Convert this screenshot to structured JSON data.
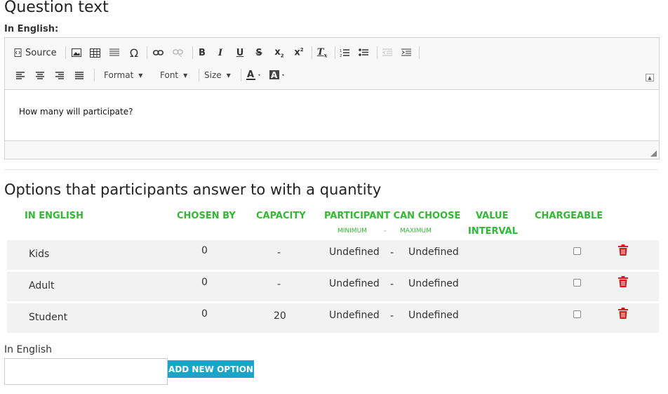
{
  "question": {
    "heading": "Question text",
    "language_label": "In English:"
  },
  "editor": {
    "toolbar_row1": {
      "source_label": "Source",
      "icons": [
        "image-icon",
        "table-icon",
        "horizontal-line-icon",
        "special-char-icon",
        "link-icon",
        "unlink-icon",
        "bold-icon",
        "italic-icon",
        "underline-icon",
        "strikethrough-icon",
        "subscript-icon",
        "superscript-icon",
        "remove-format-icon",
        "numbered-list-icon",
        "bulleted-list-icon",
        "decrease-indent-icon",
        "increase-indent-icon"
      ]
    },
    "toolbar_row2": {
      "format_label": "Format",
      "font_label": "Font",
      "size_label": "Size",
      "icons": [
        "align-left-icon",
        "align-center-icon",
        "align-right-icon",
        "justify-icon",
        "text-color-icon",
        "background-color-icon"
      ]
    },
    "content_text": "How many will participate?"
  },
  "options": {
    "heading": "Options that participants answer to with a quantity",
    "headers": {
      "language": "IN ENGLISH",
      "chosen_by": "CHOSEN BY",
      "capacity": "CAPACITY",
      "participant_can_choose": "PARTICIPANT CAN CHOOSE",
      "minimum": "MINIMUM",
      "range_separator": "-",
      "maximum": "MAXIMUM",
      "value_line1": "VALUE",
      "value_line2": "INTERVAL",
      "chargeable": "CHARGEABLE"
    },
    "rows": [
      {
        "name": "Kids",
        "chosen_by": "0",
        "capacity": "-",
        "minimum": "Undefined",
        "separator": "-",
        "maximum": "Undefined",
        "chargeable": false
      },
      {
        "name": "Adult",
        "chosen_by": "0",
        "capacity": "-",
        "minimum": "Undefined",
        "separator": "-",
        "maximum": "Undefined",
        "chargeable": false
      },
      {
        "name": "Student",
        "chosen_by": "0",
        "capacity": "20",
        "minimum": "Undefined",
        "separator": "-",
        "maximum": "Undefined",
        "chargeable": false
      }
    ]
  },
  "new_option": {
    "label": "In English",
    "value": "",
    "placeholder": "",
    "button_label": "ADD NEW OPTION"
  },
  "colors": {
    "header_green": "#33b833",
    "delete_red": "#cc1f1f",
    "button_blue": "#1aa5c8"
  }
}
